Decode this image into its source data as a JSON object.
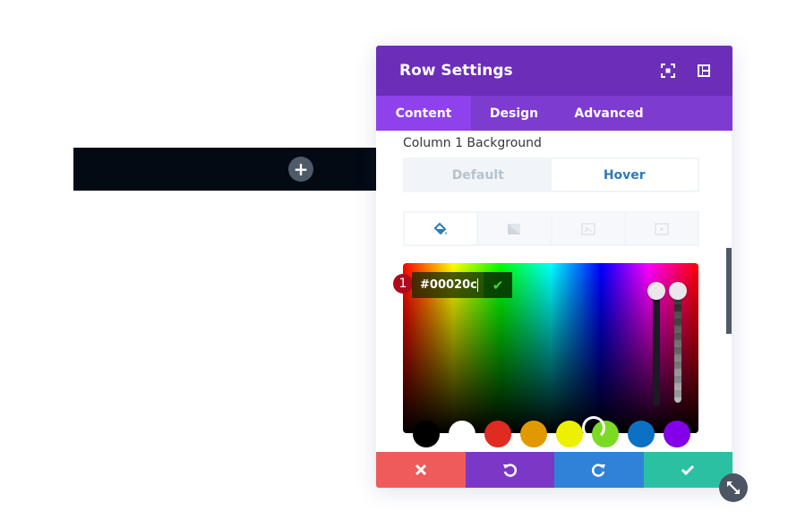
{
  "canvas": {
    "row_strip_color": "#030a14",
    "add_button_label": "+"
  },
  "modal": {
    "title": "Row Settings",
    "header_icons": [
      "expand-icon",
      "sidebar-toggle-icon"
    ],
    "tabs": [
      {
        "label": "Content",
        "active": true
      },
      {
        "label": "Design",
        "active": false
      },
      {
        "label": "Advanced",
        "active": false
      }
    ],
    "section_label": "Column 1 Background",
    "state_toggle": {
      "default_label": "Default",
      "hover_label": "Hover",
      "selected": "Hover"
    },
    "background_types": [
      {
        "icon": "paint-bucket-icon",
        "active": true
      },
      {
        "icon": "gradient-icon",
        "active": false
      },
      {
        "icon": "image-icon",
        "active": false
      },
      {
        "icon": "video-icon",
        "active": false
      }
    ],
    "color_picker": {
      "hex_value": "#00020c",
      "step_badge": "1",
      "confirm_icon": "checkmark-icon",
      "swatches": [
        "#000000",
        "#ffffff",
        "#e02b20",
        "#e09900",
        "#edf000",
        "#7cda24",
        "#0c71c3",
        "#8300e9"
      ],
      "selected_swatch_index": 5
    },
    "footer": {
      "cancel_icon": "close-icon",
      "undo_icon": "undo-icon",
      "redo_icon": "redo-icon",
      "save_icon": "checkmark-icon",
      "colors": {
        "cancel": "#ef5a5a",
        "undo": "#7b38c6",
        "redo": "#2f82d8",
        "save": "#2cc0a2"
      }
    }
  },
  "colors": {
    "header": "#6c2eb9",
    "tabs_bar": "#7e3bd0",
    "tab_active": "#8f42ec",
    "accent_blue": "#2e7bba"
  }
}
